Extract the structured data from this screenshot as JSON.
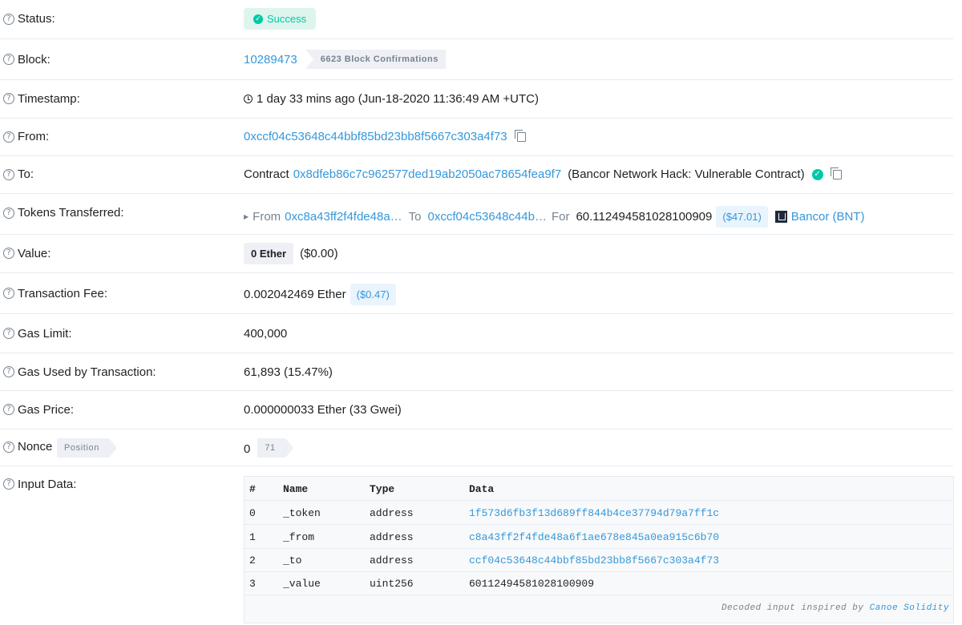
{
  "status": {
    "label": "Status:",
    "value": "Success"
  },
  "block": {
    "label": "Block:",
    "number": "10289473",
    "confirmations": "6623 Block Confirmations"
  },
  "timestamp": {
    "label": "Timestamp:",
    "value": "1 day 33 mins ago (Jun-18-2020 11:36:49 AM +UTC)"
  },
  "from": {
    "label": "From:",
    "address": "0xccf04c53648c44bbf85bd23bb8f5667c303a4f73"
  },
  "to": {
    "label": "To:",
    "prefix": "Contract",
    "address": "0x8dfeb86c7c962577ded19ab2050ac78654fea9f7",
    "name": "(Bancor Network Hack: Vulnerable Contract)"
  },
  "tokens": {
    "label": "Tokens Transferred:",
    "from_label": "From",
    "from_address": "0xc8a43ff2f4fde48a…",
    "to_label": "To",
    "to_address": "0xccf04c53648c44b…",
    "for_label": "For",
    "amount": "60.112494581028100909",
    "usd": "($47.01)",
    "token_name": "Bancor (BNT)"
  },
  "value": {
    "label": "Value:",
    "amount": "0 Ether",
    "usd": "($0.00)"
  },
  "fee": {
    "label": "Transaction Fee:",
    "amount": "0.002042469 Ether",
    "usd": "($0.47)"
  },
  "gas_limit": {
    "label": "Gas Limit:",
    "value": "400,000"
  },
  "gas_used": {
    "label": "Gas Used by Transaction:",
    "value": "61,893 (15.47%)"
  },
  "gas_price": {
    "label": "Gas Price:",
    "value": "0.000000033 Ether (33 Gwei)"
  },
  "nonce": {
    "label": "Nonce",
    "position_label": "Position",
    "value": "0",
    "position": "71"
  },
  "input": {
    "label": "Input Data:",
    "headers": [
      "#",
      "Name",
      "Type",
      "Data"
    ],
    "rows": [
      [
        "0",
        "_token",
        "address",
        "1f573d6fb3f13d689ff844b4ce37794d79a7ff1c"
      ],
      [
        "1",
        "_from",
        "address",
        "c8a43ff2f4fde48a6f1ae678e845a0ea915c6b70"
      ],
      [
        "2",
        "_to",
        "address",
        "ccf04c53648c44bbf85bd23bb8f5667c303a4f73"
      ],
      [
        "3",
        "_value",
        "uint256",
        "60112494581028100909"
      ]
    ],
    "footnote_prefix": "Decoded input inspired by",
    "footnote_link": "Canoe Solidity"
  },
  "colors": {
    "accent": "#3498db",
    "success": "#00c9a7",
    "muted": "#77838f"
  }
}
